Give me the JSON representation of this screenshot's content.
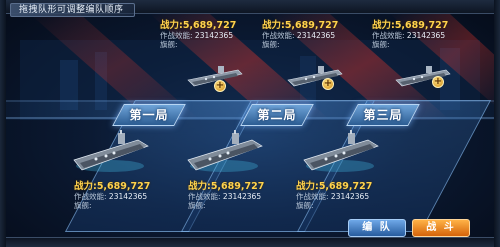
{
  "hint": "拖拽队形可调整编队顺序",
  "labels": {
    "power": "战力:",
    "combat_effect": "作战效能:",
    "flagship": "旗舰:"
  },
  "top_row": [
    {
      "power": "5,689,727",
      "effect": "23142365"
    },
    {
      "power": "5,689,727",
      "effect": "23142365"
    },
    {
      "power": "5,689,727",
      "effect": "23142365"
    }
  ],
  "teams": [
    {
      "tag": "第一局",
      "power": "5,689,727",
      "effect": "23142365"
    },
    {
      "tag": "第二局",
      "power": "5,689,727",
      "effect": "23142365"
    },
    {
      "tag": "第三局",
      "power": "5,689,727",
      "effect": "23142365"
    }
  ],
  "plus_symbol": "+",
  "buttons": {
    "formation": "编 队",
    "battle": "战 斗"
  },
  "colors": {
    "power_text": "#ffd34d",
    "formation_button": "#3f7cc4",
    "battle_button": "#f08a1c",
    "lane_glow": "#4f8fd6",
    "red_streak": "#e0342a"
  },
  "icons": [
    "aircraft-carrier-icon",
    "plus-icon"
  ]
}
